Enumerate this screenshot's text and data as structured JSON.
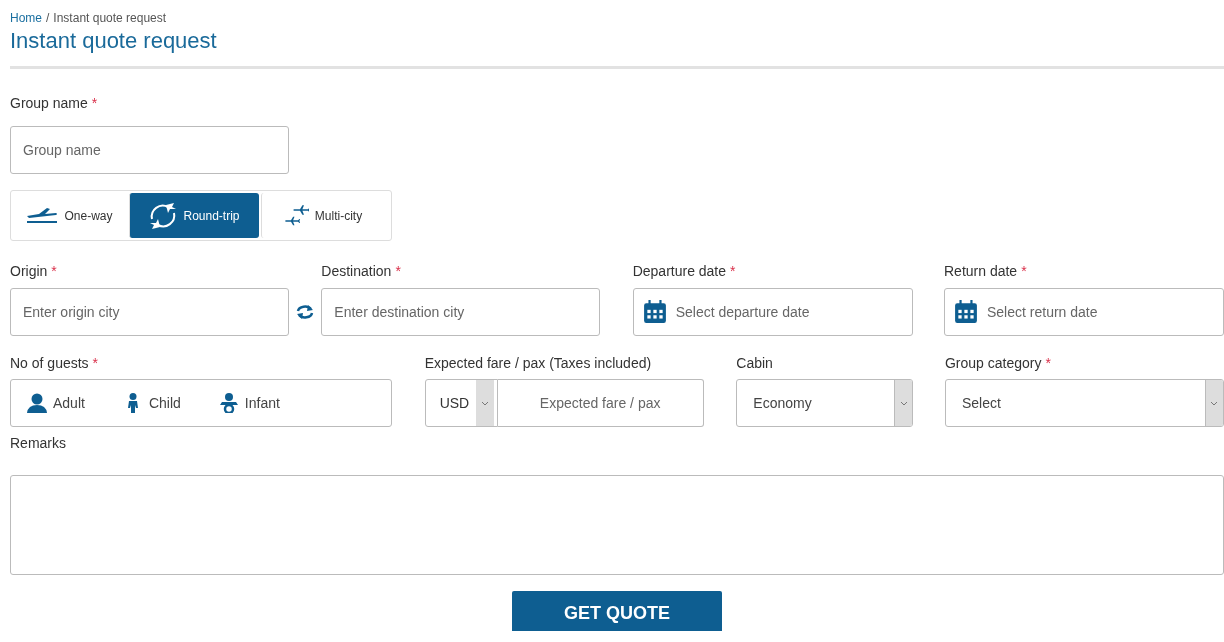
{
  "breadcrumb": [
    {
      "kind": "link",
      "label": "Home"
    },
    {
      "kind": "current",
      "separator": "/",
      "label": "Instant quote request"
    }
  ],
  "title": "Instant quote request",
  "group_name": {
    "label": "Group name",
    "required_mark": "*",
    "placeholder": "Group name"
  },
  "trip_types": [
    {
      "kind": "one-way",
      "label": "One-way",
      "selected": false
    },
    {
      "kind": "round-trip",
      "label": "Round-trip",
      "selected": true
    },
    {
      "kind": "multi-city",
      "label": "Multi-city",
      "selected": false
    }
  ],
  "origin": {
    "label": "Origin",
    "required_mark": "*",
    "placeholder": "Enter origin city"
  },
  "destination": {
    "label": "Destination",
    "required_mark": "*",
    "placeholder": "Enter destination city"
  },
  "departure_date": {
    "label": "Departure date",
    "required_mark": "*",
    "placeholder": "Select departure date"
  },
  "return_date": {
    "label": "Return date",
    "required_mark": "*",
    "placeholder": "Select return date"
  },
  "guests": {
    "label": "No of guests",
    "required_mark": "*",
    "items": [
      {
        "kind": "adult",
        "label": "Adult"
      },
      {
        "kind": "child",
        "label": "Child"
      },
      {
        "kind": "infant",
        "label": "Infant"
      }
    ]
  },
  "expected_fare": {
    "label": "Expected fare / pax (Taxes included)",
    "currency": "USD",
    "placeholder": "Expected fare / pax"
  },
  "cabin": {
    "label": "Cabin",
    "value": "Economy"
  },
  "group_category": {
    "label": "Group category",
    "required_mark": "*",
    "value": "Select"
  },
  "remarks": {
    "label": "Remarks"
  },
  "submit": "GET QUOTE"
}
